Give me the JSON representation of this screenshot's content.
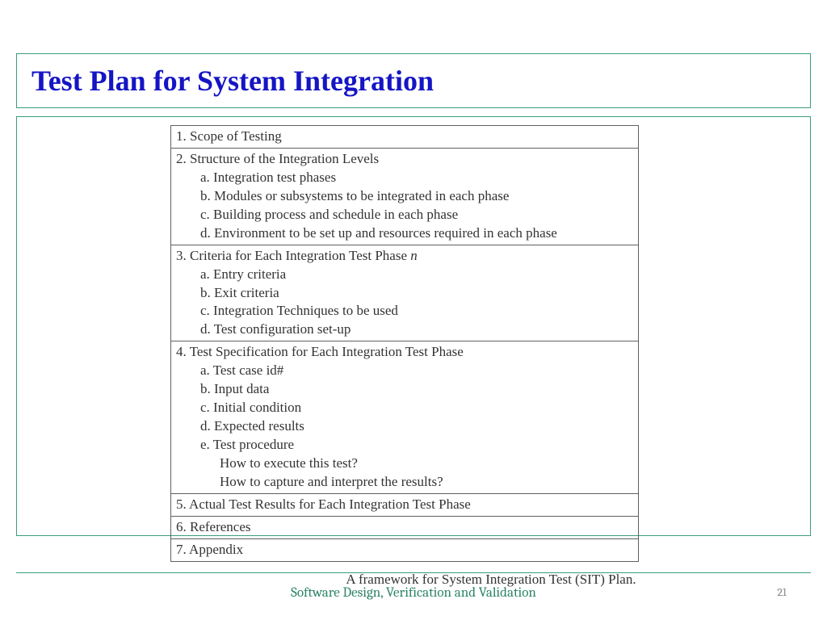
{
  "title": "Test Plan for System Integration",
  "sections": [
    {
      "heading": "1.  Scope of Testing",
      "subs": []
    },
    {
      "heading": "2.  Structure of the Integration Levels",
      "subs": [
        "a.  Integration test phases",
        "b.  Modules or subsystems to be integrated in each phase",
        "c.  Building process and schedule in each phase",
        "d.  Environment to be set up and resources required in each phase"
      ]
    },
    {
      "heading": "3.  Criteria for Each Integration Test Phase ",
      "heading_suffix_italic": "n",
      "subs": [
        "a.  Entry criteria",
        "b.  Exit criteria",
        "c.  Integration Techniques to be used",
        "d.  Test configuration set-up"
      ]
    },
    {
      "heading": "4.  Test Specification for Each Integration Test Phase",
      "subs": [
        "a.  Test case id#",
        "b.  Input data",
        "c.  Initial condition",
        "d.  Expected results",
        "e.  Test procedure"
      ],
      "subsubs": [
        "How to execute this test?",
        "How to capture and interpret the results?"
      ]
    },
    {
      "heading": "5.  Actual Test Results for Each Integration Test Phase",
      "subs": []
    },
    {
      "heading": "6.  References",
      "subs": []
    },
    {
      "heading": "7.  Appendix",
      "subs": []
    }
  ],
  "caption": "A framework for System Integration Test (SIT) Plan.",
  "footer": "Software Design, Verification and Validation",
  "page": "21"
}
